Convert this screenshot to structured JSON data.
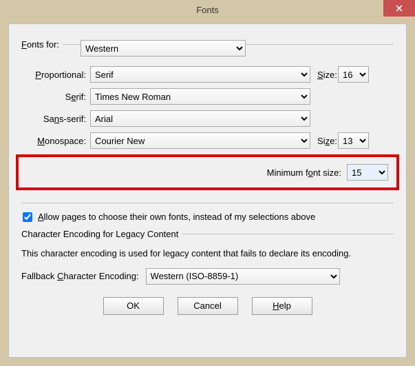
{
  "title": "Fonts",
  "labels": {
    "fonts_for": "Fonts for:",
    "proportional": "Proportional:",
    "serif": "Serif:",
    "sans_serif": "Sans-serif:",
    "monospace": "Monospace:",
    "size": "Size:",
    "min_font_size": "Minimum font size:",
    "allow_pages": "Allow pages to choose their own fonts, instead of my selections above",
    "enc_legend": "Character Encoding for Legacy Content",
    "enc_desc": "This character encoding is used for legacy content that fails to declare its encoding.",
    "fallback_enc": "Fallback Character Encoding:"
  },
  "values": {
    "fonts_for": "Western",
    "proportional": "Serif",
    "prop_size": "16",
    "serif": "Times New Roman",
    "sans_serif": "Arial",
    "monospace": "Courier New",
    "mono_size": "13",
    "min_font_size": "15",
    "allow_pages": true,
    "fallback_enc": "Western (ISO-8859-1)"
  },
  "buttons": {
    "ok": "OK",
    "cancel": "Cancel",
    "help": "Help"
  }
}
